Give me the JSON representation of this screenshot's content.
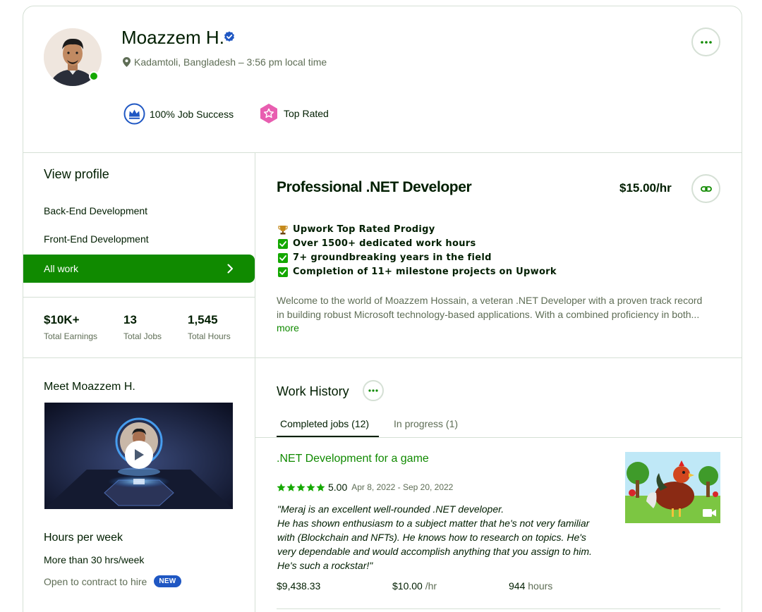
{
  "profile": {
    "name": "Moazzem H.",
    "location": "Kadamtoli, Bangladesh – 3:56 pm local time",
    "badges": {
      "job_success": "100% Job Success",
      "top_rated": "Top Rated"
    }
  },
  "sidebar": {
    "view_profile": "View profile",
    "items": [
      {
        "label": "Back-End Development"
      },
      {
        "label": "Front-End Development"
      },
      {
        "label": "All work"
      }
    ],
    "stats": [
      {
        "value": "$10K+",
        "label": "Total Earnings"
      },
      {
        "value": "13",
        "label": "Total Jobs"
      },
      {
        "value": "1,545",
        "label": "Total Hours"
      }
    ],
    "meet": "Meet Moazzem H.",
    "hours_per_week": {
      "title": "Hours per week",
      "value": "More than 30 hrs/week",
      "contract": "Open to contract to hire",
      "new_badge": "NEW"
    }
  },
  "main": {
    "title": "Professional .NET Developer",
    "rate": "$15.00/hr",
    "highlights": [
      {
        "icon": "trophy-icon",
        "text": "Upwork Top Rated Prodigy"
      },
      {
        "icon": "check-box-icon",
        "text": "Over 1500+ dedicated work hours"
      },
      {
        "icon": "check-box-icon",
        "text": "7+ groundbreaking years in the field"
      },
      {
        "icon": "check-box-icon",
        "text": "Completion of 11+ milestone projects on Upwork"
      }
    ],
    "description": [
      "Welcome to the world of Moazzem Hossain, a veteran .NET Developer with a proven track record",
      "in building robust Microsoft technology-based applications. With a combined proficiency in both..."
    ],
    "more_label": "more"
  },
  "work_history": {
    "title": "Work History",
    "tabs": [
      {
        "label": "Completed jobs (12)"
      },
      {
        "label": "In progress (1)"
      }
    ],
    "jobs": [
      {
        "title": ".NET Development for a game",
        "rating": "5.00",
        "dates": "Apr 8, 2022 - Sep 20, 2022",
        "feedback": [
          "\"Meraj is an excellent well-rounded .NET developer.",
          "He has shown enthusiasm to a subject matter that he's not very familiar",
          "with (Blockchain and NFTs). He knows how to research on topics. He's",
          "very dependable and would accomplish anything that you assign to him.",
          "He's such a rockstar!\""
        ],
        "earned": "$9,438.33",
        "rate": "$10.00",
        "rate_unit": "/hr",
        "hours": "944",
        "hours_unit": "hours"
      }
    ]
  },
  "colors": {
    "brand_green": "#108a00",
    "online_green": "#14a800",
    "text": "#001e00",
    "muted": "#5e6d55",
    "border": "#d5e0d5",
    "verified_blue": "#1f57c3",
    "top_rated_pink": "#e85eb0"
  }
}
